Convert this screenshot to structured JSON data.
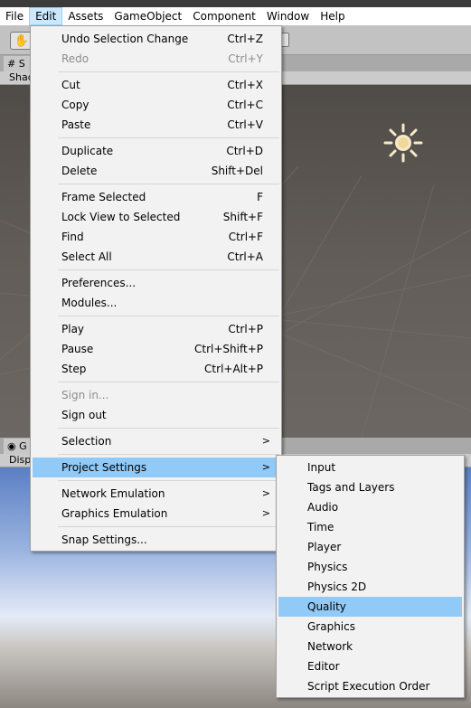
{
  "menubar": {
    "items": [
      "File",
      "Edit",
      "Assets",
      "GameObject",
      "Component",
      "Window",
      "Help"
    ],
    "active": "Edit"
  },
  "scene": {
    "tab_label": "S",
    "bar_label": "Shad"
  },
  "game": {
    "tab_label": "G",
    "bar_label": "Disp"
  },
  "edit_menu": {
    "undo": {
      "label": "Undo Selection Change",
      "shortcut": "Ctrl+Z"
    },
    "redo": {
      "label": "Redo",
      "shortcut": "Ctrl+Y"
    },
    "cut": {
      "label": "Cut",
      "shortcut": "Ctrl+X"
    },
    "copy": {
      "label": "Copy",
      "shortcut": "Ctrl+C"
    },
    "paste": {
      "label": "Paste",
      "shortcut": "Ctrl+V"
    },
    "duplicate": {
      "label": "Duplicate",
      "shortcut": "Ctrl+D"
    },
    "delete": {
      "label": "Delete",
      "shortcut": "Shift+Del"
    },
    "frame_selected": {
      "label": "Frame Selected",
      "shortcut": "F"
    },
    "lock_view": {
      "label": "Lock View to Selected",
      "shortcut": "Shift+F"
    },
    "find": {
      "label": "Find",
      "shortcut": "Ctrl+F"
    },
    "select_all": {
      "label": "Select All",
      "shortcut": "Ctrl+A"
    },
    "preferences": {
      "label": "Preferences..."
    },
    "modules": {
      "label": "Modules..."
    },
    "play": {
      "label": "Play",
      "shortcut": "Ctrl+P"
    },
    "pause": {
      "label": "Pause",
      "shortcut": "Ctrl+Shift+P"
    },
    "step": {
      "label": "Step",
      "shortcut": "Ctrl+Alt+P"
    },
    "sign_in": {
      "label": "Sign in..."
    },
    "sign_out": {
      "label": "Sign out"
    },
    "selection": {
      "label": "Selection",
      "arrow": ">"
    },
    "project_settings": {
      "label": "Project Settings",
      "arrow": ">"
    },
    "network_emulation": {
      "label": "Network Emulation",
      "arrow": ">"
    },
    "graphics_emulation": {
      "label": "Graphics Emulation",
      "arrow": ">"
    },
    "snap_settings": {
      "label": "Snap Settings..."
    }
  },
  "project_settings_menu": {
    "items": [
      "Input",
      "Tags and Layers",
      "Audio",
      "Time",
      "Player",
      "Physics",
      "Physics 2D",
      "Quality",
      "Graphics",
      "Network",
      "Editor",
      "Script Execution Order"
    ],
    "highlighted": "Quality"
  },
  "colors": {
    "menu_bg": "#f2f2f2",
    "highlight": "#91c9f7",
    "menubar_active": "#cce8ff",
    "disabled_text": "#8d8d8d"
  }
}
